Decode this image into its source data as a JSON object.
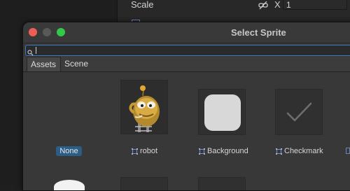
{
  "inspector": {
    "scale_label": "Scale",
    "axis_label": "X",
    "scale_x_value": "1"
  },
  "window": {
    "title": "Select Sprite",
    "search": {
      "value": "",
      "placeholder": ""
    },
    "tabs": [
      {
        "label": "Assets",
        "selected": true
      },
      {
        "label": "Scene",
        "selected": false
      }
    ],
    "items": [
      {
        "label": "None",
        "selected": true
      },
      {
        "label": "robot",
        "icon": "sprite-icon"
      },
      {
        "label": "Background",
        "icon": "sprite-icon"
      },
      {
        "label": "Checkmark",
        "icon": "sprite-icon"
      }
    ]
  },
  "colors": {
    "close": "#ec5f57",
    "zoom": "#34c84a",
    "selection": "#2c5d87",
    "search_focus": "#3a79c8"
  }
}
